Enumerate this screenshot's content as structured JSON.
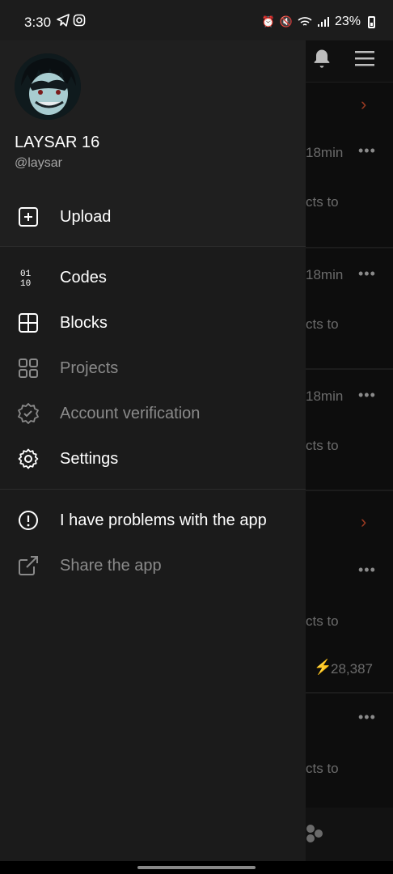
{
  "status_bar": {
    "time": "3:30",
    "battery": "23%"
  },
  "drawer": {
    "user": {
      "name": "LAYSAR 16",
      "handle": "@laysar"
    },
    "upload": {
      "label": "Upload",
      "icon": "plus-square-icon"
    },
    "items": [
      {
        "label": "Codes",
        "icon": "binary-icon",
        "enabled": true
      },
      {
        "label": "Blocks",
        "icon": "grid-icon",
        "enabled": true
      },
      {
        "label": "Projects",
        "icon": "apps-icon",
        "enabled": false
      },
      {
        "label": "Account verification",
        "icon": "verified-badge-icon",
        "enabled": false
      },
      {
        "label": "Settings",
        "icon": "gear-icon",
        "enabled": true
      }
    ],
    "support": [
      {
        "label": "I have problems with the app",
        "icon": "alert-circle-icon",
        "enabled": true
      },
      {
        "label": "Share the app",
        "icon": "share-icon",
        "enabled": false
      }
    ]
  },
  "background": {
    "times": [
      "18min",
      "18min",
      "18min"
    ],
    "snippet": "cts to",
    "count": "28,387"
  },
  "colors": {
    "drawer_bg": "#1b1b1b",
    "accent": "#9a3a22"
  }
}
